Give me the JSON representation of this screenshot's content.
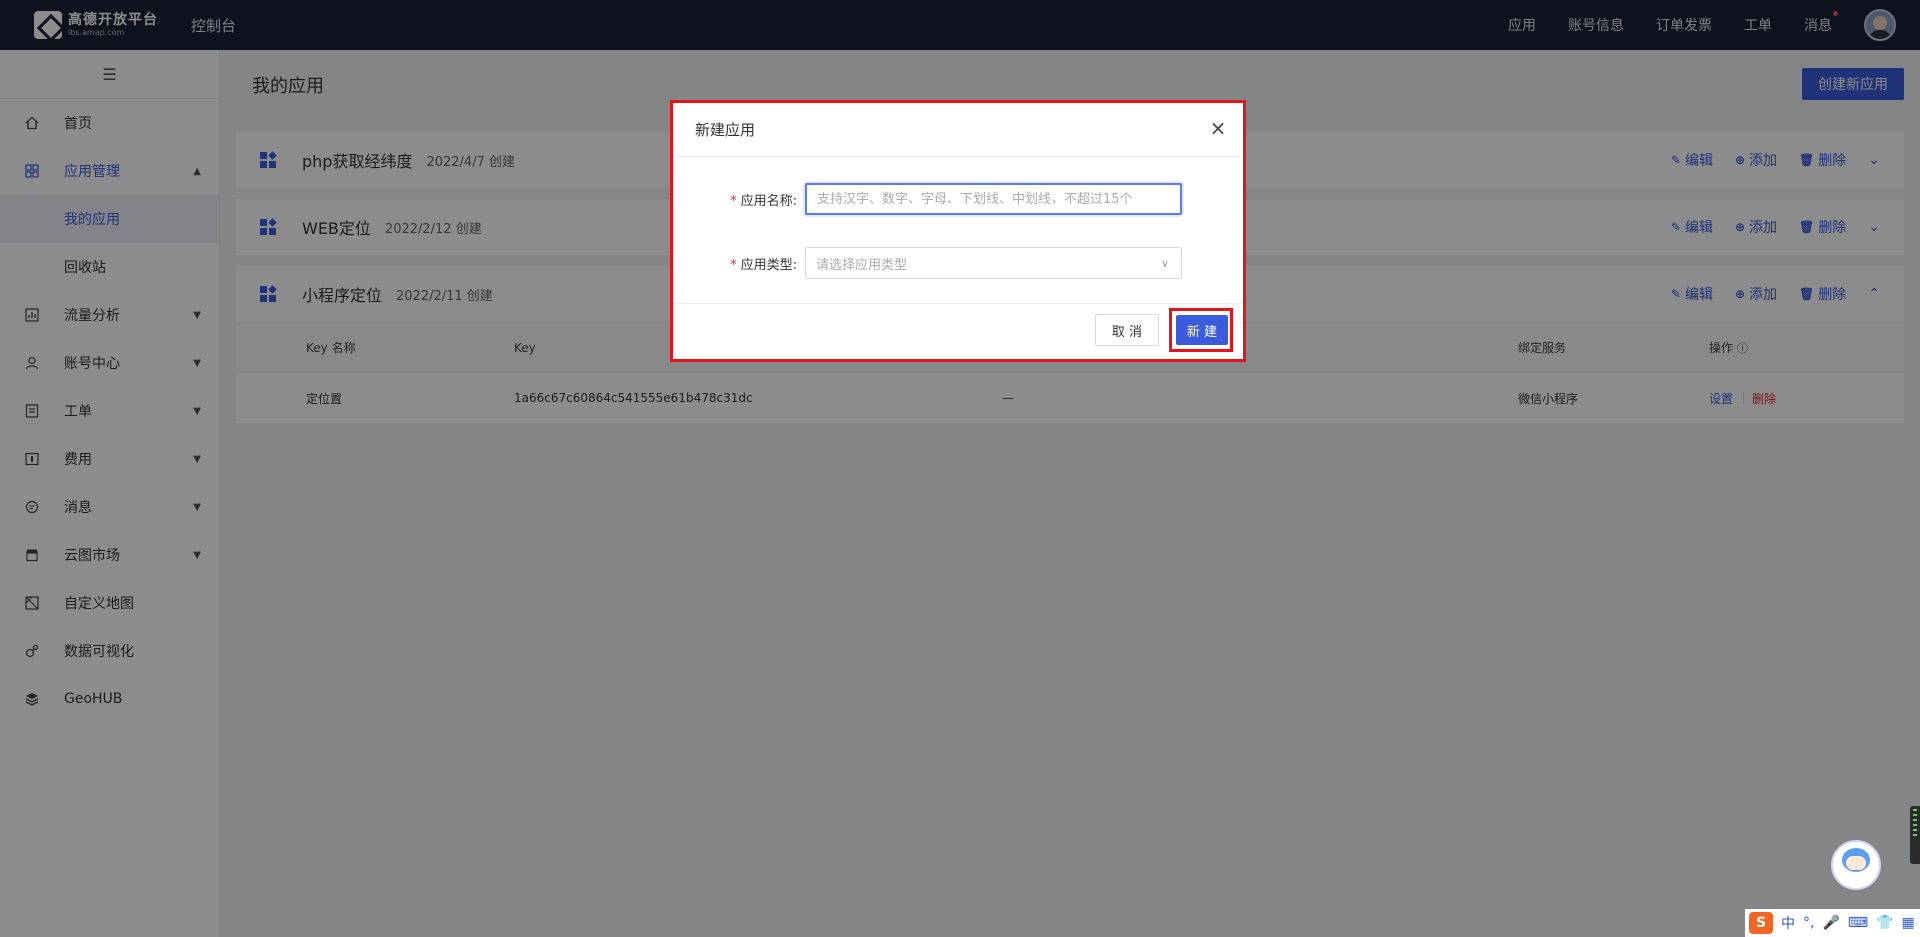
{
  "topbar": {
    "logo_name": "高德开放平台",
    "logo_sub": "lbs.amap.com",
    "console": "控制台",
    "nav": [
      "应用",
      "账号信息",
      "订单发票",
      "工单",
      "消息"
    ]
  },
  "sidebar": {
    "toggle": "☰",
    "items": [
      {
        "label": "首页",
        "icon": "home-icon"
      },
      {
        "label": "应用管理",
        "icon": "grid-icon"
      },
      {
        "label": "流量分析",
        "icon": "chart-icon"
      },
      {
        "label": "账号中心",
        "icon": "user-icon"
      },
      {
        "label": "工单",
        "icon": "ticket-icon"
      },
      {
        "label": "费用",
        "icon": "fee-icon"
      },
      {
        "label": "消息",
        "icon": "message-icon"
      },
      {
        "label": "云图市场",
        "icon": "store-icon"
      },
      {
        "label": "自定义地图",
        "icon": "map-icon"
      },
      {
        "label": "数据可视化",
        "icon": "viz-icon"
      },
      {
        "label": "GeoHUB",
        "icon": "layers-icon"
      }
    ],
    "sub_items": [
      "我的应用",
      "回收站"
    ]
  },
  "main": {
    "title": "我的应用",
    "create_button": "创建新应用",
    "apps": [
      {
        "name": "php获取经纬度",
        "date": "2022/4/7 创建"
      },
      {
        "name": "WEB定位",
        "date": "2022/2/12 创建"
      },
      {
        "name": "小程序定位",
        "date": "2022/2/11 创建"
      }
    ],
    "actions": {
      "edit": "编辑",
      "add": "添加",
      "delete": "删除"
    },
    "table": {
      "headers": [
        "Key 名称",
        "Key",
        "",
        "绑定服务",
        "操作"
      ],
      "rows": [
        {
          "name": "定位置",
          "key": "1a66c67c60864c541555e61b478c31dc",
          "col3": "—",
          "service": "微信小程序",
          "op_set": "设置",
          "op_delete": "删除"
        }
      ]
    }
  },
  "modal": {
    "title": "新建应用",
    "close": "×",
    "name_label": "应用名称:",
    "name_placeholder": "支持汉字、数字、字母、下划线、中划线，不超过15个",
    "type_label": "应用类型:",
    "type_placeholder": "请选择应用类型",
    "required_mark": "*",
    "cancel": "取 消",
    "ok": "新 建"
  },
  "ime": {
    "s": "S",
    "items": [
      "中",
      "°,",
      "🎤",
      "⌨",
      "👕",
      "▦"
    ]
  }
}
